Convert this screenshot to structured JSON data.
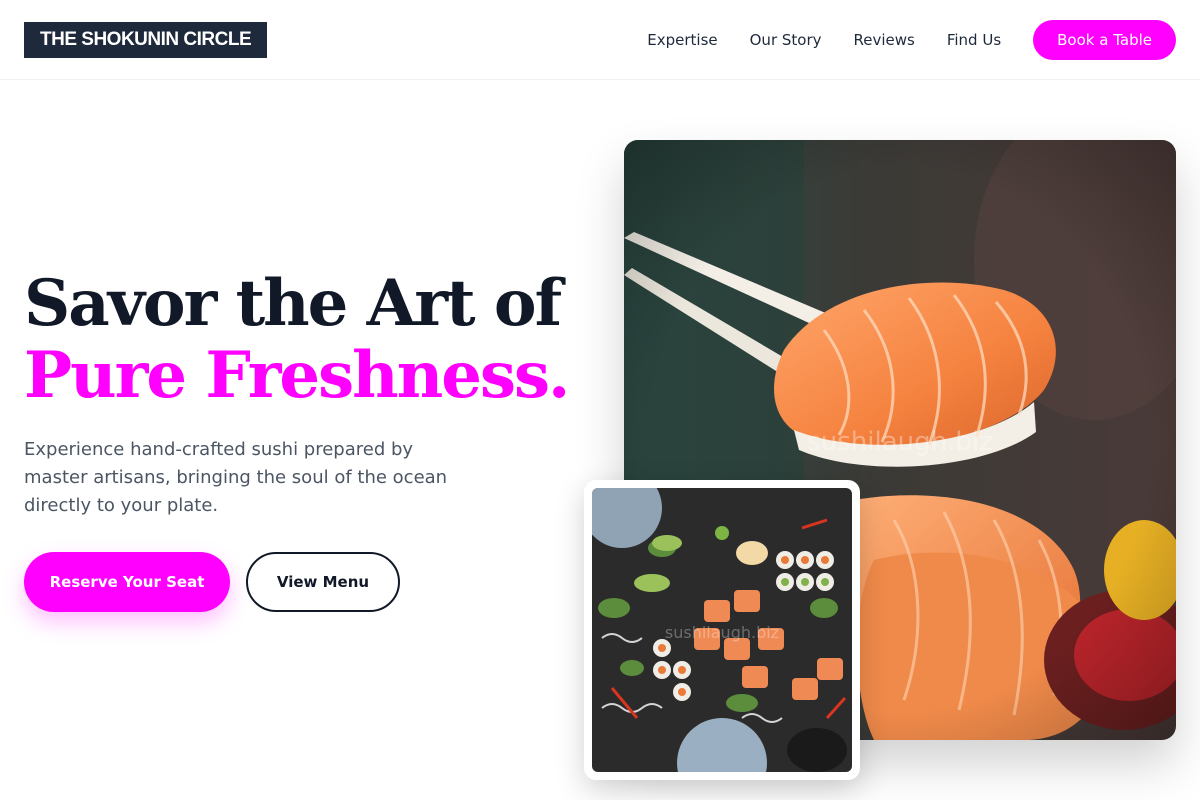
{
  "brand": {
    "name": "THE SHOKUNIN CIRCLE"
  },
  "nav": {
    "links": [
      "Expertise",
      "Our Story",
      "Reviews",
      "Find Us"
    ],
    "cta_label": "Book a Table"
  },
  "hero": {
    "headline_line1": "Savor the Art of",
    "headline_line2": "Pure Freshness.",
    "description": "Experience hand-crafted sushi prepared by master artisans, bringing the soul of the ocean directly to your plate.",
    "primary_button": "Reserve Your Seat",
    "secondary_button": "View Menu"
  },
  "images": {
    "main_watermark": "sushilaugh.biz",
    "inset_watermark": "sushilaugh.biz"
  },
  "colors": {
    "accent": "#ff00ff",
    "dark": "#1e293b",
    "body_text": "#4b5563"
  }
}
